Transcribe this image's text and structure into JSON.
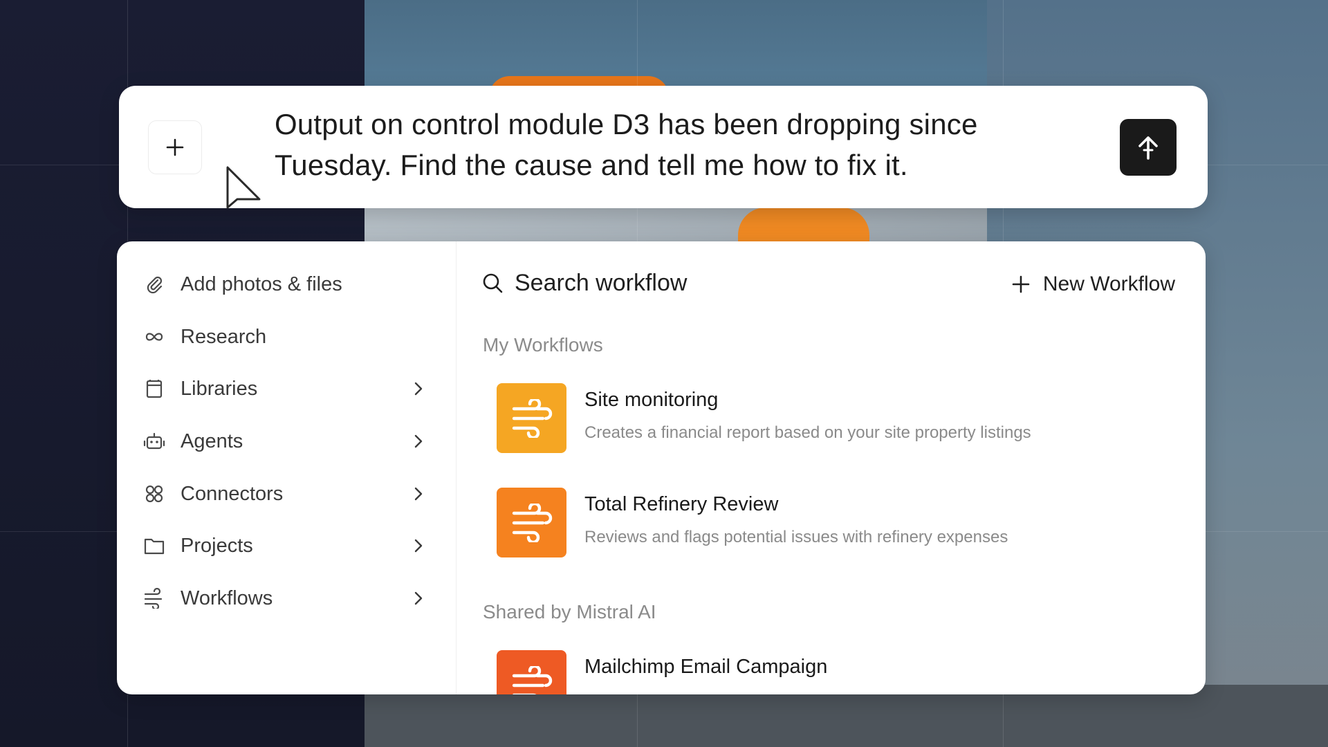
{
  "prompt": {
    "text": "Output on control module D3 has been dropping since Tuesday. Find the cause and tell me how to fix it."
  },
  "menu": {
    "items": [
      {
        "label": "Add photos & files",
        "icon": "paperclip-icon"
      },
      {
        "label": "Research",
        "icon": "infinity-icon"
      },
      {
        "label": "Libraries",
        "icon": "library-icon"
      },
      {
        "label": "Agents",
        "icon": "robot-icon"
      },
      {
        "label": "Connectors",
        "icon": "connectors-icon"
      },
      {
        "label": "Projects",
        "icon": "folder-icon"
      },
      {
        "label": "Workflows",
        "icon": "workflow-icon"
      }
    ]
  },
  "search": {
    "label": "Search workflow"
  },
  "new_workflow": {
    "label": "New Workflow"
  },
  "my_workflows": {
    "heading": "My Workflows",
    "items": [
      {
        "title": "Site monitoring",
        "description": "Creates a financial report based on your site property listings",
        "color": "#F5A623"
      },
      {
        "title": "Total Refinery Review",
        "description": "Reviews and flags potential issues with refinery expenses",
        "color": "#F5821F"
      }
    ]
  },
  "shared": {
    "heading": "Shared by Mistral AI",
    "items": [
      {
        "title": "Mailchimp Email Campaign",
        "color": "#EE5A24"
      }
    ]
  }
}
